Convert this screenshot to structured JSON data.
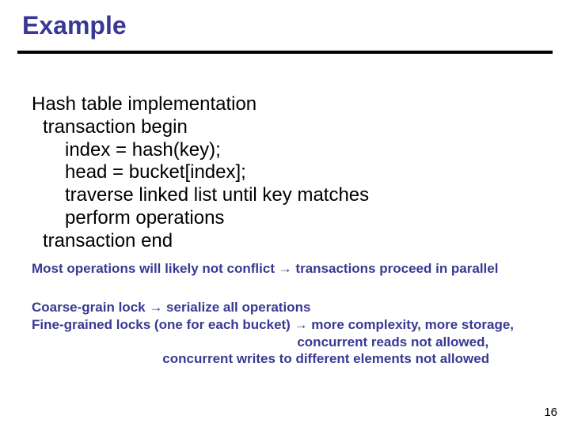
{
  "title": "Example",
  "code": {
    "l1": "Hash table implementation",
    "l2": "transaction begin",
    "l3": "index = hash(key);",
    "l4": "head = bucket[index];",
    "l5": "traverse linked list until key matches",
    "l6": "perform operations",
    "l7": "transaction end"
  },
  "note1": "Most operations will likely not conflict → transactions proceed in parallel",
  "note2": {
    "l1": "Coarse-grain lock → serialize all operations",
    "l2": "Fine-grained locks (one for each bucket) → more complexity, more storage,",
    "l3": "                                                                       concurrent reads not allowed,",
    "l4": "                                   concurrent writes to different elements not allowed"
  },
  "pagenum": "16"
}
